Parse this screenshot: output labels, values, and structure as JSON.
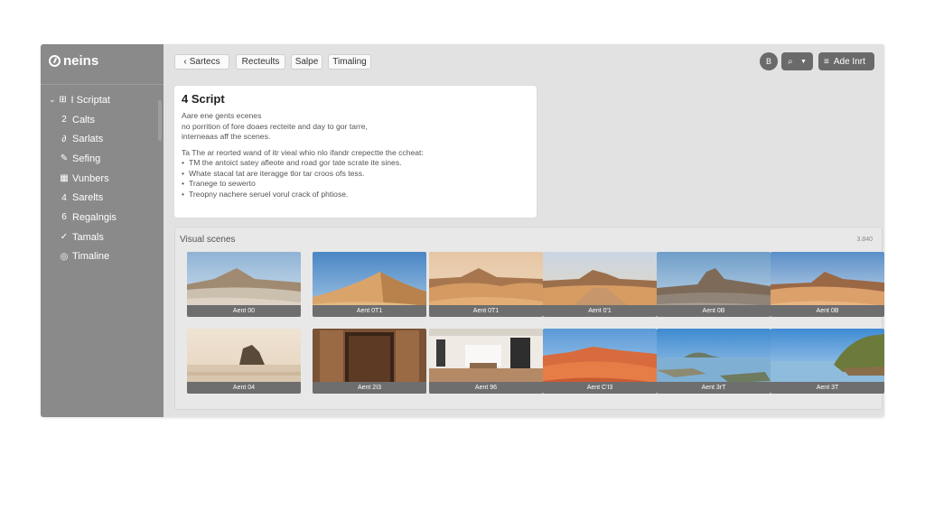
{
  "app": {
    "brand": "neins"
  },
  "sidebar": {
    "items": [
      {
        "label": "I Scriptat",
        "icon": "script-icon"
      },
      {
        "label": "Calts",
        "icon": "number-2-icon"
      },
      {
        "label": "Sarlats",
        "icon": "link-icon"
      },
      {
        "label": "Sefing",
        "icon": "pencil-icon"
      },
      {
        "label": "Vunbers",
        "icon": "grid-icon"
      },
      {
        "label": "Sarelts",
        "icon": "number-4-icon"
      },
      {
        "label": "Regalngis",
        "icon": "number-6-icon"
      },
      {
        "label": "Tamals",
        "icon": "check-icon"
      },
      {
        "label": "Timaline",
        "icon": "timeline-icon"
      }
    ]
  },
  "toolbar": {
    "back_label": "Sartecs",
    "tabs": [
      "Recteults",
      "Salpe",
      "Timaling"
    ],
    "round_button": "B",
    "add_label": "Ade Inrt"
  },
  "script": {
    "title": "4 Script",
    "intro": [
      "Aare ene gents ecenes",
      "no porrition of fore doaes recteite and day to gor tarre,",
      "interneaas aff the scenes."
    ],
    "lead": "Ta The ar reorted wand of itr vieal whio nlo ifandr crepectte the ccheat:",
    "bullets": [
      "TM the antoict satey afleote and road gor tate scrate ite sines.",
      "Whate stacal tat are iteragge tlor tar croos ofs tess.",
      "Tranege to sewerto",
      "Treopny nachere seruel vorul crack of phtiose."
    ]
  },
  "scenes": {
    "title": "Visual scenes",
    "count": "3.840",
    "items": [
      {
        "caption": "Aent 00",
        "scene": "desert-mountain"
      },
      {
        "caption": "Aent 0T1",
        "scene": "sand-dune"
      },
      {
        "caption": "Aent 0T1",
        "scene": "desert-mesa"
      },
      {
        "caption": "Aent 0'1",
        "scene": "desert-road"
      },
      {
        "caption": "Aent 0B",
        "scene": "rock-formation"
      },
      {
        "caption": "Aent 0B",
        "scene": "desert-butte"
      },
      {
        "caption": "Aent 04",
        "scene": "sea-stack"
      },
      {
        "caption": "Aent 2I3",
        "scene": "wooden-door"
      },
      {
        "caption": "Aent 96",
        "scene": "interior-room"
      },
      {
        "caption": "Aent C'I3",
        "scene": "red-dunes"
      },
      {
        "caption": "Aent 3rT",
        "scene": "lagoon"
      },
      {
        "caption": "Aent 3T",
        "scene": "coastal-cliff"
      }
    ]
  },
  "colors": {
    "sidebar": "#8a8a8a",
    "panel": "#e2e2e2",
    "caption": "#6e6e6e",
    "button": "#6a6a6a"
  }
}
